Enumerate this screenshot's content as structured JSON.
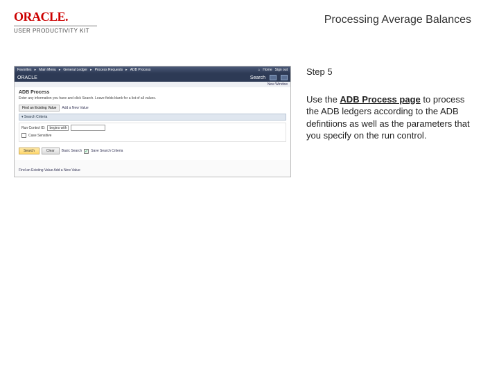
{
  "header": {
    "logo_text": "ORACLE",
    "upk_text": "USER PRODUCTIVITY KIT",
    "page_title": "Processing Average Balances"
  },
  "screenshot": {
    "top_nav": {
      "items": [
        "Favorites",
        "Main Menu",
        "General Ledger",
        "Process Requests",
        "ADB Process"
      ],
      "home": "Home",
      "signout": "Sign out"
    },
    "brand": "ORACLE",
    "search_placeholder": "Search",
    "new_window": "New Window",
    "page_heading": "ADB Process",
    "page_desc": "Enter any information you have and click Search. Leave fields blank for a list of all values.",
    "find_label": "Find an Existing Value",
    "add_label": "Add a New Value",
    "section_label": "Search Criteria",
    "run_ctl_label": "Run Control ID:",
    "begins_with": "begins with",
    "case": "Case Sensitive",
    "btn_search": "Search",
    "btn_clear": "Clear",
    "basic_search": "Basic Search",
    "save_criteria": "Save Search Criteria",
    "footer": "Find an Existing Value    Add a New Value"
  },
  "instruction": {
    "step_label": "Step 5",
    "text_pre": "Use the ",
    "bold_text": "ADB Process page",
    "text_post": " to process the ADB ledgers according to the ADB defintiions as well as the parameters that you specify on the run control."
  }
}
